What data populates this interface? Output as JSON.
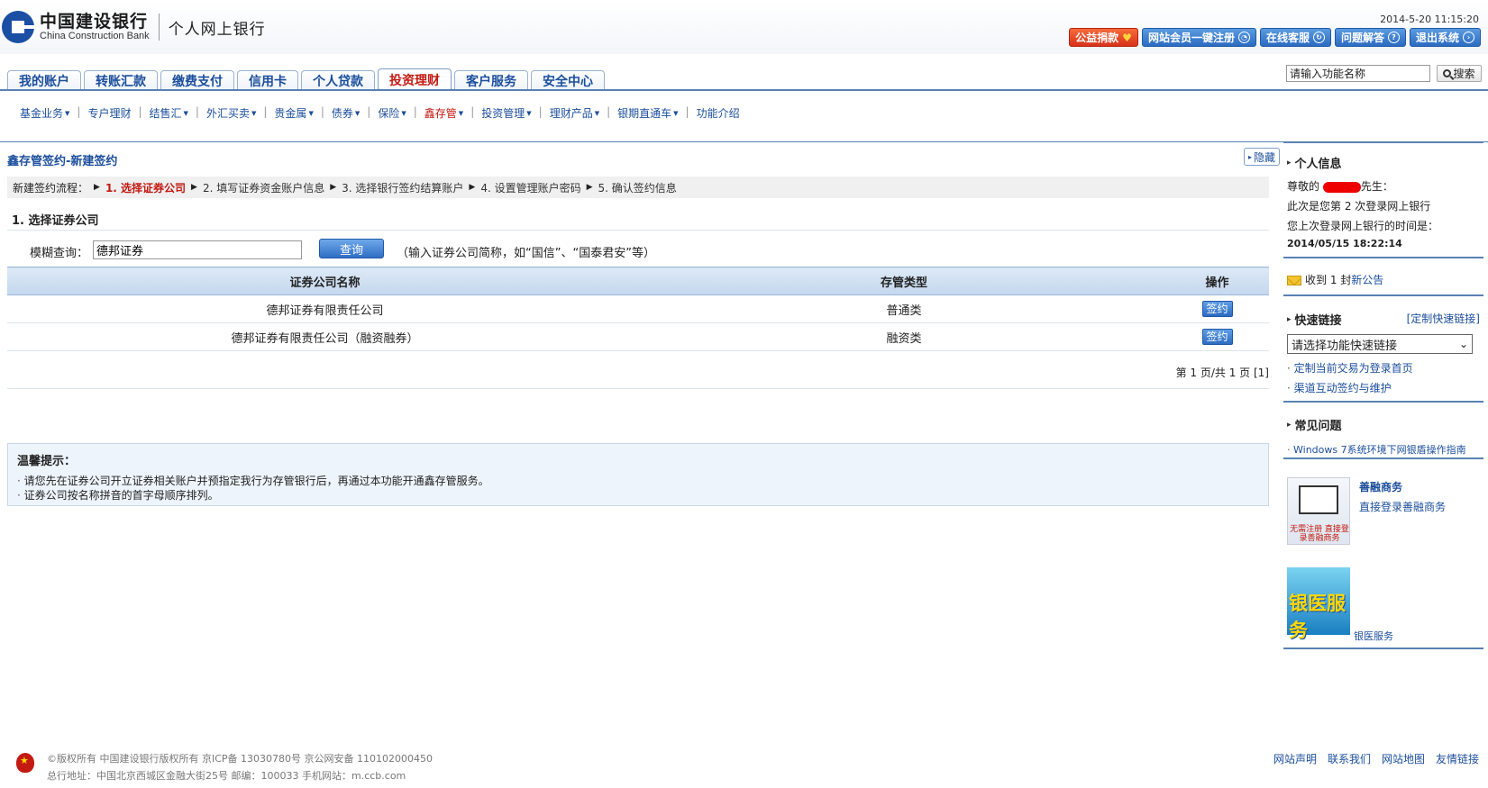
{
  "header": {
    "brand_cn": "中国建设银行",
    "brand_en": "China Construction Bank",
    "subtitle": "个人网上银行",
    "datetime": "2014-5-20 11:15:20",
    "buttons": [
      "公益捐款",
      "网站会员一键注册",
      "在线客服",
      "问题解答",
      "退出系统"
    ]
  },
  "nav": {
    "tabs": [
      "我的账户",
      "转账汇款",
      "缴费支付",
      "信用卡",
      "个人贷款",
      "投资理财",
      "客户服务",
      "安全中心"
    ],
    "active_tab": "投资理财",
    "search_placeholder": "请输入功能名称",
    "search_button": "搜索"
  },
  "subnav": {
    "items": [
      "基金业务",
      "专户理财",
      "结售汇",
      "外汇买卖",
      "贵金属",
      "债券",
      "保险",
      "鑫存管",
      "投资管理",
      "理财产品",
      "银期直通车",
      "功能介绍"
    ]
  },
  "main": {
    "title": "鑫存管签约-新建签约",
    "hide_button": "隐藏",
    "steps_label": "新建签约流程：",
    "steps": [
      "1. 选择证券公司",
      "2. 填写证券资金账户信息",
      "3. 选择银行签约结算账户",
      "4. 设置管理账户密码",
      "5. 确认签约信息"
    ],
    "section_title": "1. 选择证券公司",
    "query_label": "模糊查询：",
    "query_value": "德邦证券",
    "query_button": "查询",
    "query_hint": "（输入证券公司简称，如“国信”、“国泰君安”等）",
    "table": {
      "headers": [
        "证券公司名称",
        "存管类型",
        "操作"
      ],
      "rows": [
        {
          "name": "德邦证券有限责任公司",
          "type": "普通类",
          "action": "签约"
        },
        {
          "name": "德邦证券有限责任公司（融资融券）",
          "type": "融资类",
          "action": "签约"
        }
      ]
    },
    "pager": "第 1 页/共 1 页 [1]",
    "tips_title": "温馨提示：",
    "tips": [
      "请您先在证券公司开立证券相关账户并预指定我行为存管银行后，再通过本功能开通鑫存管服务。",
      "证券公司按名称拼音的首字母顺序排列。"
    ]
  },
  "sidebar": {
    "personal_title": "个人信息",
    "greeting_prefix": "尊敬的",
    "greeting_suffix": "先生：",
    "login_count": "此次是您第 2 次登录网上银行",
    "last_login_label": "您上次登录网上银行的时间是：",
    "last_login_time": "2014/05/15 18:22:14",
    "notice_prefix": "收到 1 封",
    "notice_link": "新公告",
    "quick_title": "快速链接",
    "quick_custom": "[定制快速链接]",
    "quick_select": "请选择功能快速链接",
    "quick_links": [
      "定制当前交易为登录首页",
      "渠道互动签约与维护"
    ],
    "faq_title": "常见问题",
    "faq_links": [
      "Windows 7系统环境下网银盾操作指南"
    ],
    "promo1_title": "善融商务",
    "promo1_link": "直接登录善融商务",
    "promo1_caption": "无需注册 直接登录善融商务",
    "promo2_text": "银医服务",
    "promo2_caption": "银医服务"
  },
  "footer": {
    "line1": "©版权所有 中国建设银行版权所有  京ICP备 13030780号  京公网安备 110102000450",
    "line2": "总行地址：中国北京西城区金融大街25号  邮编：100033  手机网站：m.ccb.com",
    "links": [
      "网站声明",
      "联系我们",
      "网站地图",
      "友情链接"
    ]
  }
}
